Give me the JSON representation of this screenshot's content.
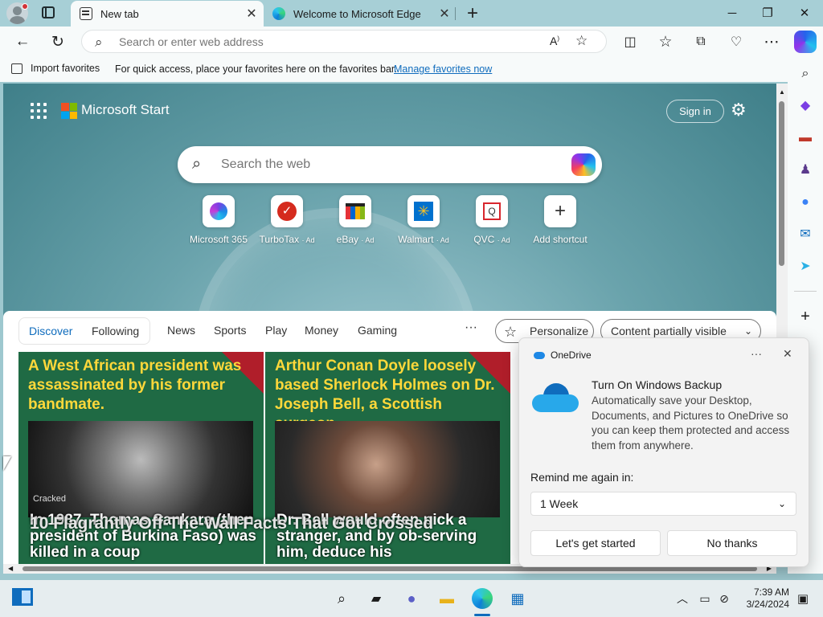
{
  "tabs": [
    {
      "title": "New tab",
      "active": true
    },
    {
      "title": "Welcome to Microsoft Edge",
      "active": false
    }
  ],
  "address_bar": {
    "placeholder": "Search or enter web address"
  },
  "favorites_bar": {
    "import_label": "Import favorites",
    "message": "For quick access, place your favorites here on the favorites bar.",
    "link": "Manage favorites now"
  },
  "start": {
    "brand": "Microsoft Start",
    "sign_in": "Sign in",
    "search_placeholder": "Search the web",
    "logo_colors": [
      "#f25022",
      "#7fba00",
      "#00a4ef",
      "#ffb900"
    ]
  },
  "shortcuts": [
    {
      "name": "Microsoft 365",
      "ad": ""
    },
    {
      "name": "TurboTax",
      "ad": "· Ad"
    },
    {
      "name": "eBay",
      "ad": "· Ad"
    },
    {
      "name": "Walmart",
      "ad": "· Ad"
    },
    {
      "name": "QVC",
      "ad": "· Ad"
    },
    {
      "name": "Add shortcut",
      "ad": ""
    }
  ],
  "feed": {
    "tabs": [
      "Discover",
      "Following"
    ],
    "nav": [
      "News",
      "Sports",
      "Play",
      "Money",
      "Gaming"
    ],
    "more": "···",
    "personalize": "Personalize",
    "content_visibility": "Content partially visible",
    "cards": [
      {
        "headline": "A West African president was assassinated by his former bandmate.",
        "subtext": "In 1987, Thomas Sankara (then president of Burkina Faso) was killed in a coup",
        "source": "Cracked",
        "overlay": "10 Flagrantly Off-The-Wall Facts That Got Crossed"
      },
      {
        "headline": "Arthur Conan Doyle loosely based Sherlock Holmes on Dr. Joseph Bell, a Scottish surgeon.",
        "subtext": "Dr. Bell would often pick a stranger, and by ob-serving him, deduce his",
        "source": "",
        "overlay": ""
      }
    ]
  },
  "onedrive": {
    "app": "OneDrive",
    "title": "Turn On Windows Backup",
    "description": "Automatically save your Desktop, Documents, and Pictures to OneDrive so you can keep them protected and access them from anywhere.",
    "remind_label": "Remind me again in:",
    "remind_value": "1 Week",
    "primary": "Let's get started",
    "secondary": "No thanks"
  },
  "taskbar": {
    "time": "7:39 AM",
    "date": "3/24/2024"
  }
}
